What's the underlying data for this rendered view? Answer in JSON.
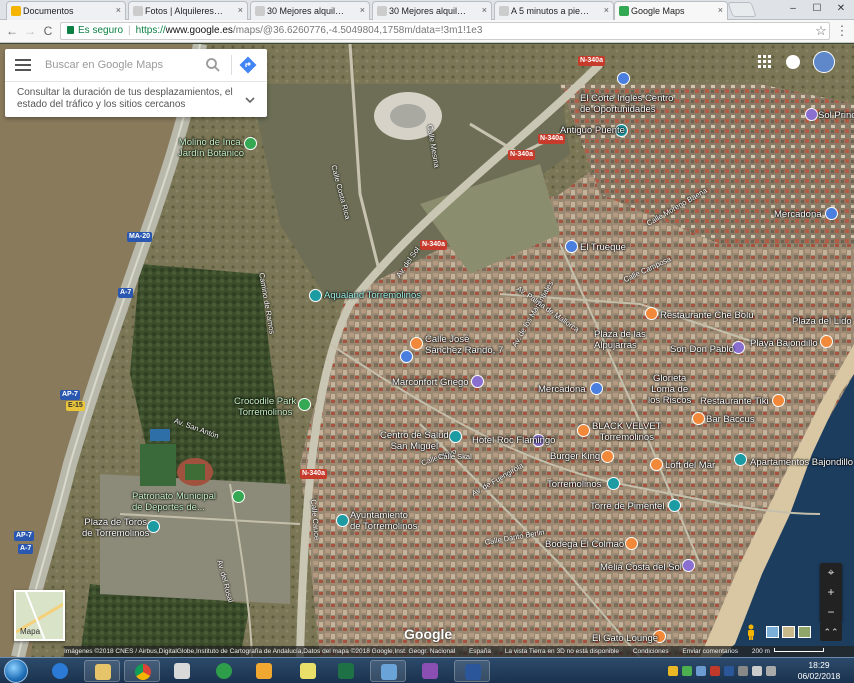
{
  "browser": {
    "tabs": [
      {
        "label": "Documentos",
        "icon": "docs-icon",
        "color": "#f4b400",
        "active": false
      },
      {
        "label": "Fotos | Alquileres vaca",
        "icon": "page-icon",
        "color": "#e8e8e8",
        "active": false
      },
      {
        "label": "30 Mejores alquiler ap",
        "icon": "page-icon",
        "color": "#e8e8e8",
        "active": false
      },
      {
        "label": "30 Mejores alquiler ap",
        "icon": "page-icon",
        "color": "#e8e8e8",
        "active": false
      },
      {
        "label": "A 5 minutos a pie del",
        "icon": "page-icon",
        "color": "#e8e8e8",
        "active": false
      },
      {
        "label": "Google Maps",
        "icon": "maps-icon",
        "color": "#34a853",
        "active": true
      }
    ],
    "tab_close_glyph": "×",
    "window_controls": {
      "minimize": "–",
      "maximize": "☐",
      "close": "✕"
    },
    "nav": {
      "back": "←",
      "forward": "→",
      "reload": "C"
    },
    "address": {
      "secure_label": "Es seguro",
      "url_scheme": "https://",
      "url_host": "www.google.es",
      "url_path": "/maps/@36.6260776,-4.5049804,1758m/data=!3m1!1e3",
      "star": "☆",
      "menu": "⋮"
    }
  },
  "search": {
    "placeholder": "Buscar en Google Maps",
    "commute_text": "Consultar la duración de tus desplazamientos, el estado del tráfico y los sitios cercanos"
  },
  "map": {
    "places": [
      {
        "name": "Molino de Inca,\nJardín Botánico",
        "pin": "green"
      },
      {
        "name": "Aqualand Torremolinos",
        "pin": "teal"
      },
      {
        "name": "Calle José\nSánchez Rando, 7",
        "pin": "orange"
      },
      {
        "name": "Marconfort Griego",
        "pin": "purple"
      },
      {
        "name": "Crocodile Park\nTorremolinos",
        "pin": "green"
      },
      {
        "name": "Centro de Salud\nSan Miguel",
        "pin": "teal"
      },
      {
        "name": "Hotel Roc Flamingo",
        "pin": "purple"
      },
      {
        "name": "Patronato Municipal\nde Deportes de...",
        "pin": "green"
      },
      {
        "name": "Plaza de Toros\nde Torremolinos",
        "pin": "teal"
      },
      {
        "name": "Ayuntamiento\nde Torremolinos",
        "pin": "teal"
      },
      {
        "name": "El Corte Inglés Centro\nde Oportunidades",
        "pin": "blue"
      },
      {
        "name": "Antiguo Puente",
        "pin": "teal"
      },
      {
        "name": "El Trueque",
        "pin": "blue"
      },
      {
        "name": "Mercadona",
        "pin": "blue"
      },
      {
        "name": "Mercadona",
        "pin": "blue"
      },
      {
        "name": "Plaza de las\nAlpujarras",
        "pin": "blue"
      },
      {
        "name": "Restaurante Che Bolu",
        "pin": "orange"
      },
      {
        "name": "Plaza del Lido",
        "pin": "blue"
      },
      {
        "name": "Son Don Pablo",
        "pin": "purple"
      },
      {
        "name": "Playa Bajondillo",
        "pin": "orange"
      },
      {
        "name": "Glorieta\nLoma de\nlos Riscos",
        "pin": "blue"
      },
      {
        "name": "Restaurante Tiki",
        "pin": "orange"
      },
      {
        "name": "Bar Baccus",
        "pin": "orange"
      },
      {
        "name": "BLACK VELVET\nTorremolinos",
        "pin": "orange"
      },
      {
        "name": "Burger King",
        "pin": "orange"
      },
      {
        "name": "Loft del Mar",
        "pin": "orange"
      },
      {
        "name": "Apartamentos Bajondillo",
        "pin": "teal"
      },
      {
        "name": "Torremolinos",
        "pin": "teal"
      },
      {
        "name": "Torre de Pimentel",
        "pin": "teal"
      },
      {
        "name": "Bodega El Colmao",
        "pin": "orange"
      },
      {
        "name": "Meliá Costa del Sol",
        "pin": "purple"
      },
      {
        "name": "El Gato Lounge",
        "pin": "orange"
      },
      {
        "name": "Sol Princ",
        "pin": "purple"
      }
    ],
    "roads": [
      "MA-20",
      "A-7",
      "AP-7",
      "N-340a",
      "N-340a",
      "N-340a",
      "N-340a",
      "N-340a",
      "E-15",
      "AP-7",
      "A-7",
      "Calle Costa Rica",
      "Calle Mesina",
      "Av. del Sol",
      "Av. de los Manantiales",
      "Calle Moreno Baena",
      "Calle Camposa",
      "Av. Palma de Mallorca",
      "Calle Hoyo",
      "Calle Cauce",
      "Av. de Fuengirola",
      "Calle Skal",
      "Calle Danto Berlin",
      "Av. San Antón",
      "Av. del Rosal",
      "Camino de Ramos"
    ],
    "google_logo": "Google",
    "minimap_label": "Mapa",
    "attribution": [
      "Imágenes ©2018 CNES / Airbus,DigitalGlobe,Instituto de Cartografía de Andalucía,Datos del mapa ©2018 Google,Inst. Geogr. Nacional",
      "España",
      "La vista Tierra en 3D no está disponible",
      "Condiciones",
      "Enviar comentarios",
      "200 m"
    ],
    "zoom_in": "+",
    "zoom_out": "−",
    "tilt": "⌃⌃",
    "compass": "⌖"
  },
  "taskbar": {
    "apps": [
      "windows-explorer",
      "internet-explorer",
      "chrome",
      "outlook",
      "maps-app",
      "jpg-viewer",
      "pdf",
      "excel",
      "photo-viewer",
      "onenote",
      "word"
    ],
    "time": "18:29",
    "date": "06/02/2018"
  },
  "colors": {
    "maps_blue": "#4285f4",
    "taskbar": "#1a324e",
    "accent_green": "#0b8043"
  }
}
